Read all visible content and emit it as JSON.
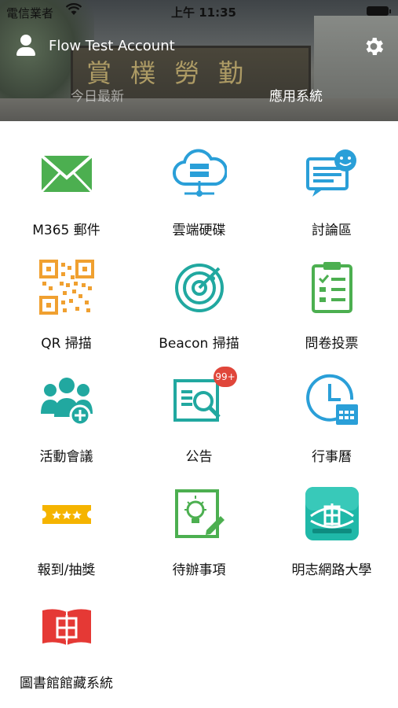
{
  "status_bar": {
    "carrier": "電信業者",
    "time": "上午 11:35"
  },
  "account": {
    "name": "Flow Test Account"
  },
  "header_sign": "賞樸勞勤",
  "tabs": [
    {
      "label": "今日最新"
    },
    {
      "label": "應用系統"
    }
  ],
  "apps": [
    {
      "label": "M365 郵件",
      "icon": "mail-icon"
    },
    {
      "label": "雲端硬碟",
      "icon": "cloud-server-icon"
    },
    {
      "label": "討論區",
      "icon": "chat-bubble-icon"
    },
    {
      "label": "QR 掃描",
      "icon": "qr-code-icon"
    },
    {
      "label": "Beacon 掃描",
      "icon": "radar-icon"
    },
    {
      "label": "問卷投票",
      "icon": "clipboard-checklist-icon"
    },
    {
      "label": "活動會議",
      "icon": "people-group-icon"
    },
    {
      "label": "公告",
      "icon": "announcement-icon",
      "badge": "99+"
    },
    {
      "label": "行事曆",
      "icon": "clock-calendar-icon"
    },
    {
      "label": "報到/抽獎",
      "icon": "ticket-icon"
    },
    {
      "label": "待辦事項",
      "icon": "idea-note-icon"
    },
    {
      "label": "明志網路大學",
      "icon": "mingchi-online-logo"
    },
    {
      "label": "圖書館館藏系統",
      "icon": "library-book-icon"
    }
  ],
  "colors": {
    "green": "#4caf50",
    "blue": "#2a9fd8",
    "teal": "#21a8a0",
    "orange": "#f0a030",
    "yellow": "#f5b400",
    "red": "#e53935",
    "badge": "#e0463a"
  }
}
